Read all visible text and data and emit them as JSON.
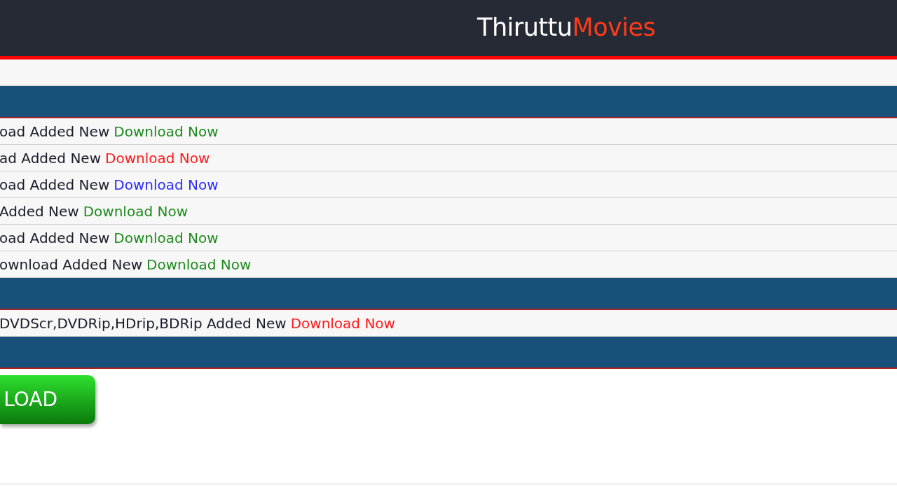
{
  "header": {
    "logo_first": "Thiruttu",
    "logo_second": "Movies"
  },
  "sections": [
    {
      "rows": [
        {
          "text": "oad Added New",
          "link": "Download Now",
          "color": "#1e8a1e"
        },
        {
          "text": "ad Added New",
          "link": "Download Now",
          "color": "#ff1a1a"
        },
        {
          "text": "oad Added New",
          "link": "Download Now",
          "color": "#2b2bff"
        },
        {
          "text": "Added New",
          "link": "Download Now",
          "color": "#1e8a1e"
        },
        {
          "text": "oad Added New",
          "link": "Download Now",
          "color": "#1e8a1e"
        },
        {
          "text": "ownload Added New",
          "link": "Download Now",
          "color": "#1e8a1e"
        }
      ]
    },
    {
      "rows": [
        {
          "text": "DVDScr,DVDRip,HDrip,BDRip Added New",
          "link": "Download Now",
          "color": "#ff1a1a"
        }
      ]
    }
  ],
  "download_button": {
    "label": "LOAD"
  }
}
